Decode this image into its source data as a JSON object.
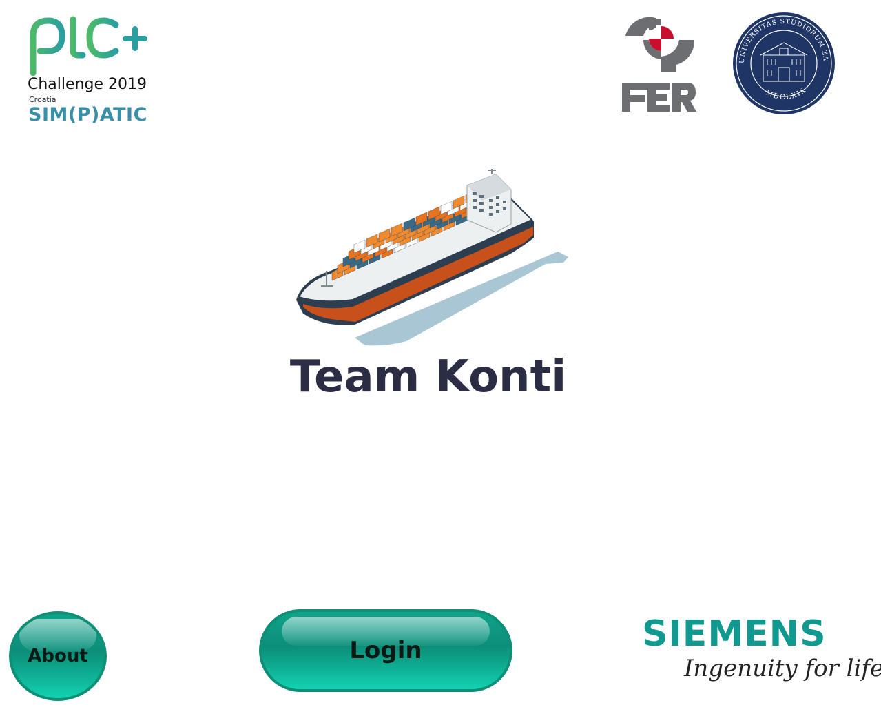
{
  "branding": {
    "plc": {
      "wordmark": "PLC+",
      "subtitle": "Challenge 2019",
      "country": "Croatia",
      "organizer": "SIM(P)ATIC",
      "colors": {
        "green": "#4cba6a",
        "teal": "#2a9fa0",
        "organizer": "#3a8fa8"
      }
    },
    "fer": {
      "wordmark": "FER",
      "colors": {
        "grey": "#6d6e71",
        "red": "#c8102e"
      }
    },
    "university": {
      "seal_text": "UNIVERSITAS STUDIORUM ZAGRABIENSIS",
      "seal_year": "MDCLXIX",
      "color": "#1f3566"
    },
    "siemens": {
      "wordmark": "SIEMENS",
      "tagline": "Ingenuity for life",
      "color": "#10998f"
    }
  },
  "main": {
    "title": "Team Konti",
    "illustration": "container-ship-icon"
  },
  "buttons": {
    "about": "About",
    "login": "Login"
  },
  "colors": {
    "button_fill": "#0fa38a",
    "button_border": "#0e8f76",
    "title_text": "#2a2d44",
    "hull_orange": "#c8501a",
    "container_orange": "#f08a2e",
    "container_blue": "#3b6a86",
    "water_shadow": "#a9c6d5"
  }
}
